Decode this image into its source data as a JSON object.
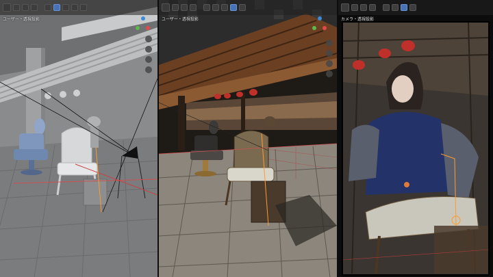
{
  "viewports": {
    "left": {
      "label": "ユーザー・透視投影",
      "shading": "solid"
    },
    "middle": {
      "label": "ユーザー・透視投影",
      "shading": "rendered"
    },
    "right": {
      "label": "カメラ・透視投影",
      "shading": "camera-render"
    }
  },
  "header_icons": [
    "select-tool-icon",
    "cursor-icon",
    "view-menu-icon",
    "object-menu-icon",
    "overlay-icon",
    "shading-solid-icon",
    "shading-material-icon",
    "shading-rendered-icon",
    "search-icon"
  ],
  "navigation_icons": [
    "zoom-icon",
    "pan-icon",
    "camera-view-icon",
    "grid-view-icon"
  ],
  "colors": {
    "gizmo_x": "#e04a4a",
    "gizmo_y": "#5fb84b",
    "gizmo_z": "#3f8ad6",
    "active_button": "#4772b3"
  }
}
